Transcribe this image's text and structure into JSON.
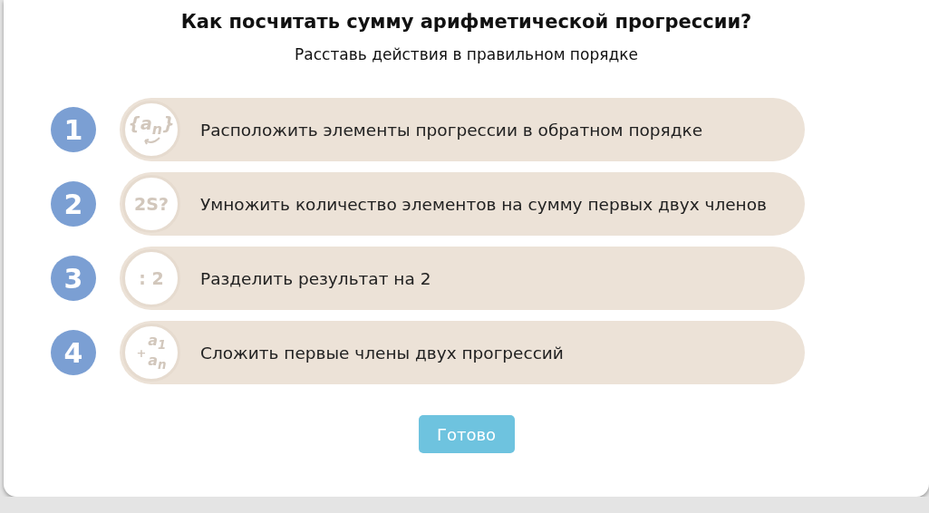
{
  "title": "Как посчитать сумму арифметической прогрессии?",
  "subtitle": "Расставь действия в правильном порядке",
  "steps": [
    {
      "number": "1",
      "kind": "reverse",
      "glyph_lines": [
        "{a$_{n}$}"
      ],
      "text": "Расположить элементы прогрессии в обратном порядке"
    },
    {
      "number": "2",
      "kind": "plain",
      "glyph_lines": [
        "2S?"
      ],
      "text": "Умножить количество элементов на сумму первых двух членов"
    },
    {
      "number": "3",
      "kind": "plain",
      "glyph_lines": [
        ": 2"
      ],
      "text": "Разделить результат на 2"
    },
    {
      "number": "4",
      "kind": "sum",
      "glyph_lines": [
        "+",
        "a$_{1}$",
        "a$_{n}$"
      ],
      "text": "Сложить первые члены двух прогрессий"
    }
  ],
  "button": "Готово"
}
